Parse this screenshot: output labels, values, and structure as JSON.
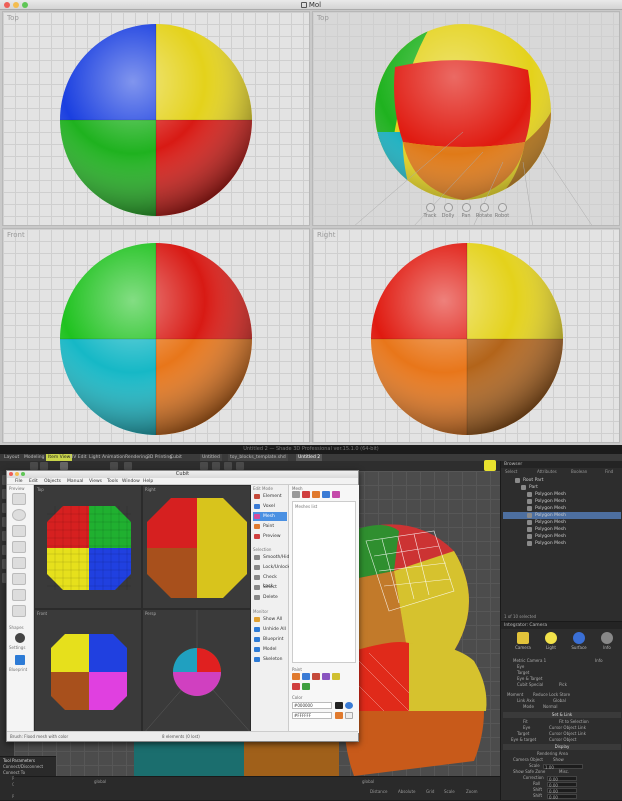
{
  "mol": {
    "title": "Mol",
    "viewports": [
      {
        "label": "Top"
      },
      {
        "label": "Top"
      },
      {
        "label": "Front"
      },
      {
        "label": "Right"
      }
    ],
    "nav": [
      {
        "label": "Track",
        "icon": "track-icon"
      },
      {
        "label": "Dolly",
        "icon": "dolly-icon"
      },
      {
        "label": "Pan",
        "icon": "pan-icon"
      },
      {
        "label": "Rotate",
        "icon": "rotate-icon"
      },
      {
        "label": "Robot",
        "icon": "robot-icon"
      }
    ]
  },
  "shade": {
    "title": "Untitled 2 — Shade 3D Professional ver.15.1.0 (64-bit)",
    "menu_tabs": [
      "Layout",
      "Modeling",
      "Item View",
      "UV Edit",
      "Light",
      "Animation",
      "Rendering",
      "3D Printing",
      "Cubit"
    ],
    "active_tab": "Item View",
    "doc_tabs": [
      "Untitled",
      "toy_blocks_template.shd",
      "Untitled 2"
    ],
    "left_labels": [
      "Settings",
      "Objects",
      "Blueprint"
    ],
    "viewport_coord_left": "global",
    "viewport_coord_right": "global",
    "status_items": [
      "Distance",
      "Absolute",
      "Grid",
      "Scale",
      "Zoom"
    ],
    "tool_params": {
      "title": "Tool Parameters",
      "items": [
        "Connect/Disconnect",
        "Connect To",
        "Polygon Meshes",
        "Cut to Surfaces",
        "Line Object",
        "Polygon Meshes"
      ]
    }
  },
  "cubit": {
    "title": "Cubit",
    "menu": [
      "File",
      "Edit",
      "Objects",
      "Manual",
      "Views",
      "Tools",
      "Window",
      "Help"
    ],
    "view_labels": [
      "Top",
      "Right",
      "Front",
      "Persp"
    ],
    "edit_mode_label": "Edit Mode",
    "edit_mode": [
      {
        "label": "Element",
        "color": "#c54a3a"
      },
      {
        "label": "Voxel",
        "color": "#3a7bd5"
      },
      {
        "label": "Mesh",
        "color": "#d54a9a"
      },
      {
        "label": "Paint",
        "color": "#e07a2e"
      },
      {
        "label": "Preview",
        "color": "#d04040"
      }
    ],
    "active_mode": "Mesh",
    "selection_label": "Selection",
    "selection": [
      "Smooth/Hide",
      "Lock/Unlock",
      "Check Lock",
      "Select",
      "Delete"
    ],
    "monitor_label": "Monitor",
    "monitor": [
      "Show All",
      "Unhide All",
      "Blueprint",
      "Model",
      "Skeleton"
    ],
    "mesh_label": "Mesh",
    "mesh_list_label": "Meshes list",
    "paint_label": "Paint",
    "color_label": "Color",
    "colors": [
      "#000000",
      "#FFFFFF"
    ],
    "status": "Brush: Flood mesh with color",
    "status_right": "8 elements (0 lost)",
    "left_preview_label": "Preview",
    "left_shapes_label": "Shapes",
    "left_settings_label": "Settings",
    "left_blueprint_label": "Blueprint"
  },
  "browser": {
    "title": "Browser",
    "columns": [
      "Select",
      "Attributes",
      "Boolean",
      "Find"
    ],
    "tree": [
      {
        "label": "Root Part",
        "depth": 0,
        "selected": false
      },
      {
        "label": "Part",
        "depth": 1,
        "selected": false
      },
      {
        "label": "Polygon Mesh",
        "depth": 2,
        "selected": false
      },
      {
        "label": "Polygon Mesh",
        "depth": 2,
        "selected": false
      },
      {
        "label": "Polygon Mesh",
        "depth": 2,
        "selected": false
      },
      {
        "label": "Polygon Mesh",
        "depth": 2,
        "selected": true
      },
      {
        "label": "Polygon Mesh",
        "depth": 2,
        "selected": false
      },
      {
        "label": "Polygon Mesh",
        "depth": 2,
        "selected": false
      },
      {
        "label": "Polygon Mesh",
        "depth": 2,
        "selected": false
      },
      {
        "label": "Polygon Mesh",
        "depth": 2,
        "selected": false
      }
    ],
    "footer": "1 of 10 selected"
  },
  "camera_panel": {
    "title": "Integrator: Camera",
    "icons": [
      {
        "label": "Camera",
        "color": "#e2c33a"
      },
      {
        "label": "Light",
        "color": "#f2e24a"
      },
      {
        "label": "Surface",
        "color": "#3a6fd5"
      },
      {
        "label": "Info",
        "color": "#888888"
      }
    ],
    "rows": [
      {
        "k": "Metric Camera 1",
        "v": "Info"
      },
      {
        "k": "Eye",
        "v": ""
      },
      {
        "k": "Target",
        "v": ""
      },
      {
        "k": "Eye & Target",
        "v": ""
      },
      {
        "k": "Cubit Special",
        "v": "Pick"
      },
      {
        "k": "Moment",
        "v": "Reduce  Lock  Store"
      },
      {
        "k": "Link Axis",
        "v": "Global"
      },
      {
        "k": "Mode",
        "v": "Normal"
      }
    ],
    "section1": "Set & Link",
    "rows2": [
      {
        "k": "Fit",
        "v": "Fit to Selection"
      },
      {
        "k": "Eye",
        "v": "Cursor  Object  Link"
      },
      {
        "k": "Target",
        "v": "Cursor  Object  Link"
      },
      {
        "k": "Eye & target",
        "v": "Cursor  Object"
      }
    ],
    "section2": "Display",
    "rows3": [
      {
        "k": "Rendering Area",
        "v": ""
      },
      {
        "k": "Camera Object",
        "v": "Show"
      },
      {
        "k": "Scale",
        "v": "1.00"
      },
      {
        "k": "Show Safe Zone",
        "v": "Misc."
      },
      {
        "k": "Correction",
        "v": "0.00"
      },
      {
        "k": "Roll",
        "v": "0.00"
      },
      {
        "k": "Shift",
        "v": "0.00"
      },
      {
        "k": "Shift",
        "v": "0.00"
      },
      {
        "k": "Plan Shift",
        "v": "0.00"
      }
    ]
  }
}
